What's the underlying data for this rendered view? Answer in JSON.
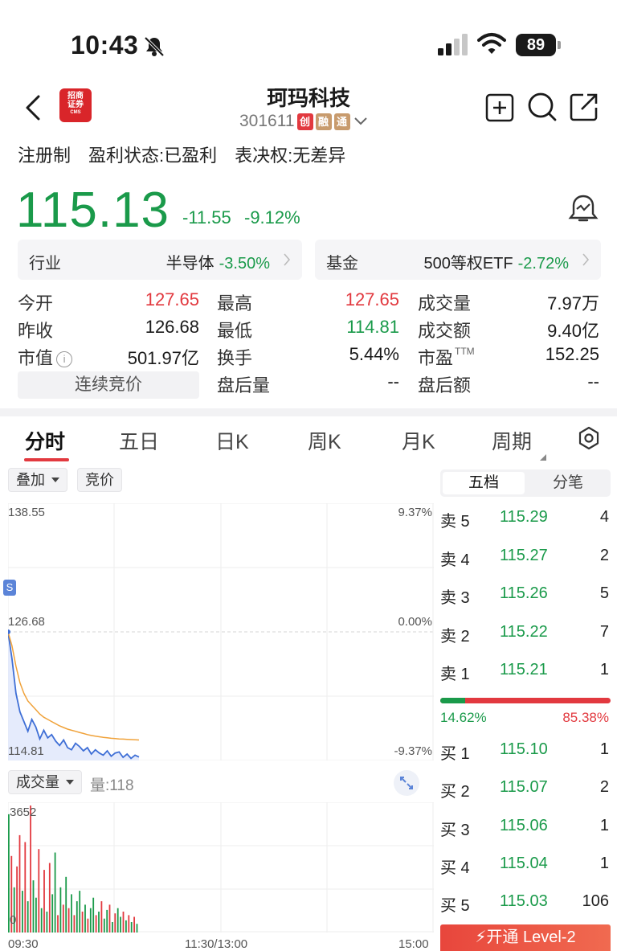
{
  "status": {
    "time": "10:43",
    "battery": "89"
  },
  "header": {
    "broker_logo_top": "招商",
    "broker_logo_bottom": "证券",
    "broker_logo_sub": "CMS",
    "name": "珂玛科技",
    "code": "301611",
    "tags": [
      "创",
      "融",
      "通"
    ]
  },
  "info": {
    "reg": "注册制",
    "profit": "盈利状态:已盈利",
    "vote": "表决权:无差异"
  },
  "price": {
    "last": "115.13",
    "change": "-11.55",
    "change_pct": "-9.12%"
  },
  "sector": {
    "industry_label": "行业",
    "industry_name": "半导体",
    "industry_pct": "-3.50%",
    "fund_label": "基金",
    "fund_name": "500等权ETF",
    "fund_pct": "-2.72%"
  },
  "quotes": {
    "open_lbl": "今开",
    "open": "127.65",
    "high_lbl": "最高",
    "high": "127.65",
    "volume_lbl": "成交量",
    "volume": "7.97万",
    "prev_lbl": "昨收",
    "prev": "126.68",
    "low_lbl": "最低",
    "low": "114.81",
    "amount_lbl": "成交额",
    "amount": "9.40亿",
    "mcap_lbl": "市值",
    "mcap": "501.97亿",
    "turnover_lbl": "换手",
    "turnover": "5.44%",
    "pe_lbl": "市盈",
    "pe_sup": "TTM",
    "pe": "152.25",
    "auction_btn": "连续竞价",
    "after_vol_lbl": "盘后量",
    "after_vol": "--",
    "after_amt_lbl": "盘后额",
    "after_amt": "--"
  },
  "tabs": [
    "分时",
    "五日",
    "日K",
    "周K",
    "月K",
    "周期"
  ],
  "chart_tools": {
    "overlay": "叠加",
    "auction": "竞价",
    "volume_btn": "成交量",
    "volume_value": "量:118",
    "marker": "S"
  },
  "chart_data": {
    "type": "line",
    "y_labels": {
      "top": "138.55",
      "mid": "126.68",
      "bottom": "114.81"
    },
    "pct_labels": {
      "top": "9.37%",
      "mid": "0.00%",
      "bottom": "-9.37%"
    },
    "ylim": [
      114.81,
      138.55
    ],
    "price": [
      126.68,
      124.2,
      121.0,
      119.3,
      118.4,
      117.5,
      118.6,
      117.9,
      116.8,
      117.6,
      116.9,
      117.2,
      116.6,
      116.2,
      116.7,
      116.0,
      115.8,
      116.4,
      116.1,
      115.7,
      116.0,
      115.4,
      115.8,
      115.5,
      115.3,
      115.7,
      115.2,
      115.5,
      115.6,
      115.1,
      115.4,
      115.0,
      115.3,
      115.13
    ],
    "avg": [
      126.68,
      125.4,
      123.5,
      122.0,
      121.0,
      120.3,
      119.9,
      119.5,
      119.1,
      118.8,
      118.6,
      118.4,
      118.2,
      118.0,
      117.85,
      117.7,
      117.6,
      117.5,
      117.4,
      117.3,
      117.2,
      117.12,
      117.05,
      117.0,
      116.95,
      116.9,
      116.86,
      116.83,
      116.8,
      116.78,
      116.76,
      116.74,
      116.72,
      116.7
    ],
    "volume_max_label": "3652",
    "volume_min_label": "0",
    "volume_max": 3652,
    "volumes": [
      3400,
      2200,
      1300,
      1900,
      2800,
      1200,
      2600,
      900,
      3652,
      1500,
      1000,
      2400,
      700,
      1800,
      600,
      2000,
      1100,
      2300,
      500,
      1300,
      800,
      1600,
      700,
      1100,
      500,
      900,
      1200,
      600,
      800,
      400,
      700,
      1000,
      500,
      600,
      900,
      400,
      650,
      800,
      300,
      550,
      700,
      450,
      600,
      350,
      500,
      300,
      450,
      250
    ],
    "volume_up": [
      false,
      true,
      false,
      true,
      true,
      false,
      true,
      false,
      true,
      false,
      false,
      true,
      false,
      true,
      false,
      true,
      false,
      false,
      true,
      false,
      true,
      false,
      true,
      false,
      true,
      false,
      false,
      true,
      false,
      true,
      false,
      false,
      true,
      false,
      true,
      false,
      false,
      true,
      false,
      true,
      false,
      false,
      true,
      false,
      true,
      false,
      true,
      false
    ],
    "time_labels": [
      "09:30",
      "11:30/13:00",
      "15:00"
    ]
  },
  "orderbook": {
    "tab_active": "五档",
    "tab_other": "分笔",
    "asks": [
      {
        "side": "卖 5",
        "price": "115.29",
        "qty": "4"
      },
      {
        "side": "卖 4",
        "price": "115.27",
        "qty": "2"
      },
      {
        "side": "卖 3",
        "price": "115.26",
        "qty": "5"
      },
      {
        "side": "卖 2",
        "price": "115.22",
        "qty": "7"
      },
      {
        "side": "卖 1",
        "price": "115.21",
        "qty": "1"
      }
    ],
    "buy_ratio": "14.62%",
    "sell_ratio": "85.38%",
    "buy_ratio_value": 14.62,
    "bids": [
      {
        "side": "买 1",
        "price": "115.10",
        "qty": "1"
      },
      {
        "side": "买 2",
        "price": "115.07",
        "qty": "2"
      },
      {
        "side": "买 3",
        "price": "115.06",
        "qty": "1"
      },
      {
        "side": "买 4",
        "price": "115.04",
        "qty": "1"
      },
      {
        "side": "买 5",
        "price": "115.03",
        "qty": "106"
      }
    ],
    "level2_btn": "开通 Level-2"
  },
  "colors": {
    "up": "#e2393f",
    "down": "#1a9a4a",
    "avg": "#f0a23a",
    "price_line": "#3f6fd6"
  }
}
